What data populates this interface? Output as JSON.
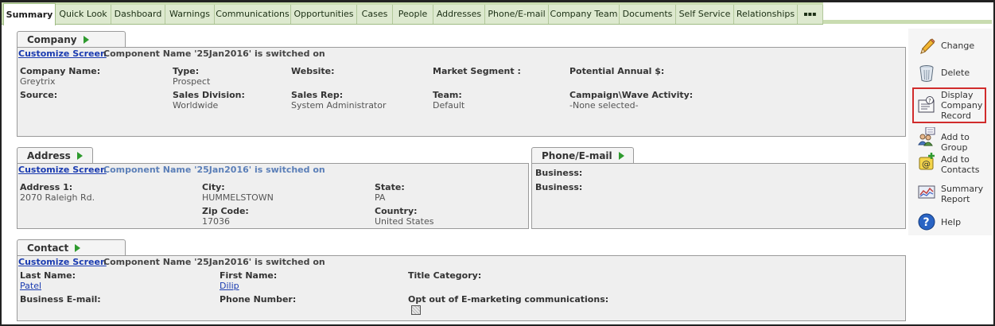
{
  "tabs": [
    {
      "label": "Summary",
      "active": true
    },
    {
      "label": "Quick Look"
    },
    {
      "label": "Dashboard"
    },
    {
      "label": "Warnings"
    },
    {
      "label": "Communications"
    },
    {
      "label": "Opportunities"
    },
    {
      "label": "Cases"
    },
    {
      "label": "People"
    },
    {
      "label": "Addresses"
    },
    {
      "label": "Phone/E-mail"
    },
    {
      "label": "Company Team"
    },
    {
      "label": "Documents"
    },
    {
      "label": "Self Service"
    },
    {
      "label": "Relationships"
    },
    {
      "label": "▪▪▪"
    }
  ],
  "company": {
    "title": "Company",
    "customize": "Customize Screen",
    "component_note": "Component Name '25Jan2016' is switched on",
    "name_label": "Company Name:",
    "name_value": "Greytrix",
    "type_label": "Type:",
    "type_value": "Prospect",
    "website_label": "Website:",
    "segment_label": "Market Segment :",
    "potential_label": "Potential Annual $:",
    "source_label": "Source:",
    "division_label": "Sales Division:",
    "division_value": "Worldwide",
    "rep_label": "Sales Rep:",
    "rep_value": "System Administrator",
    "team_label": "Team:",
    "team_value": "Default",
    "campaign_label": "Campaign\\Wave Activity:",
    "campaign_value": "-None selected-"
  },
  "address": {
    "title": "Address",
    "customize": "Customize Screen",
    "component_note": "Component Name '25Jan2016' is switched on",
    "addr1_label": "Address 1:",
    "addr1_value": "2070 Raleigh Rd.",
    "city_label": "City:",
    "city_value": "HUMMELSTOWN",
    "state_label": "State:",
    "state_value": "PA",
    "zip_label": "Zip Code:",
    "zip_value": "17036",
    "country_label": "Country:",
    "country_value": "United States"
  },
  "phone": {
    "title": "Phone/E-mail",
    "business1_label": "Business:",
    "business2_label": "Business:"
  },
  "contact": {
    "title": "Contact",
    "customize": "Customize Screen",
    "component_note": "Component Name '25Jan2016' is switched on",
    "last_label": "Last Name:",
    "last_value": "Patel",
    "first_label": "First Name:",
    "first_value": "Dilip",
    "title_cat_label": "Title Category:",
    "email_label": "Business E-mail:",
    "phone_label": "Phone Number:",
    "optout_label": "Opt out of E-marketing communications:"
  },
  "actions": {
    "change": "Change",
    "delete": "Delete",
    "display": "Display Company Record",
    "add_group": "Add to Group",
    "add_contacts": "Add to Contacts",
    "summary_report": "Summary Report",
    "help": "Help"
  },
  "colors": {
    "tab_bar": "#c9dcb0",
    "panel_bg": "#efefef",
    "link": "#1a3bb0",
    "highlight": "#d12c2c",
    "arrow": "#2e9a2e"
  }
}
